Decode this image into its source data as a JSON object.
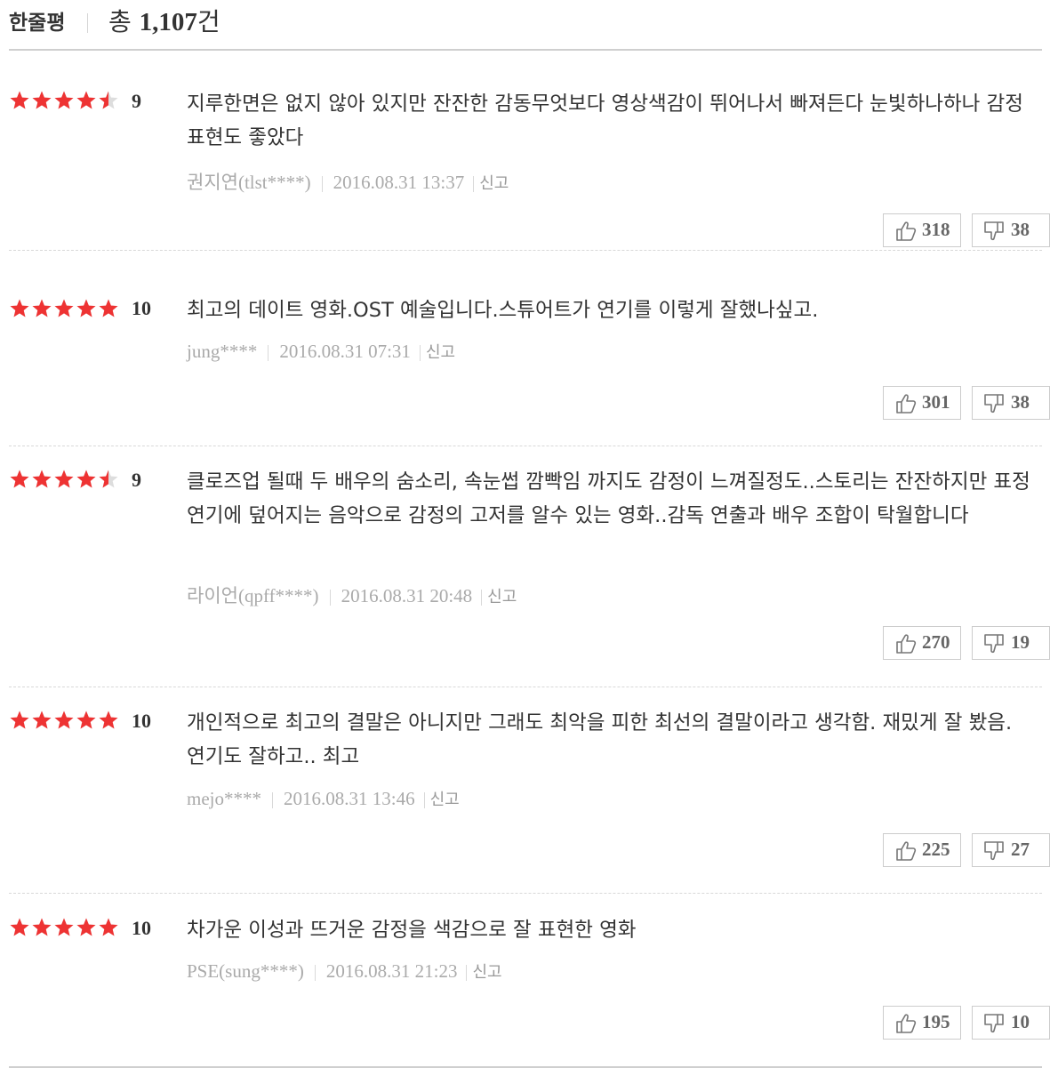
{
  "header": {
    "title": "한줄평",
    "total_prefix": "총",
    "total_count": "1,107",
    "total_suffix": "건"
  },
  "colors": {
    "star_full": "#ee3333",
    "star_empty": "#dddddd",
    "meta": "#aaaaaa"
  },
  "report_label": "신고",
  "reviews": [
    {
      "rating": 4.5,
      "score": "9",
      "comment": "지루한면은 없지 않아 있지만 잔잔한 감동무엇보다 영상색감이 뛰어나서 빠져든다 눈빛하나하나 감정표현도 좋았다",
      "author": "권지연(tlst****)",
      "date": "2016.08.31 13:37",
      "likes": "318",
      "dislikes": "38"
    },
    {
      "rating": 5,
      "score": "10",
      "comment": "최고의 데이트 영화.OST 예술입니다.스튜어트가 연기를 이렇게 잘했나싶고.",
      "author": "jung****",
      "date": "2016.08.31 07:31",
      "likes": "301",
      "dislikes": "38"
    },
    {
      "rating": 4.5,
      "score": "9",
      "comment": "클로즈업 될때 두 배우의 숨소리, 속눈썹 깜빡임 까지도 감정이 느껴질정도..스토리는 잔잔하지만 표정연기에 덮어지는 음악으로 감정의 고저를 알수 있는 영화..감독 연출과 배우 조합이 탁월합니다",
      "author": "라이언(qpff****)",
      "date": "2016.08.31 20:48",
      "likes": "270",
      "dislikes": "19"
    },
    {
      "rating": 5,
      "score": "10",
      "comment": "개인적으로 최고의 결말은 아니지만 그래도 최악을 피한 최선의 결말이라고 생각함. 재밌게 잘 봤음. 연기도 잘하고.. 최고",
      "author": "mejo****",
      "date": "2016.08.31 13:46",
      "likes": "225",
      "dislikes": "27"
    },
    {
      "rating": 5,
      "score": "10",
      "comment": "차가운 이성과 뜨거운 감정을 색감으로 잘 표현한 영화",
      "author": "PSE(sung****)",
      "date": "2016.08.31 21:23",
      "likes": "195",
      "dislikes": "10"
    }
  ]
}
